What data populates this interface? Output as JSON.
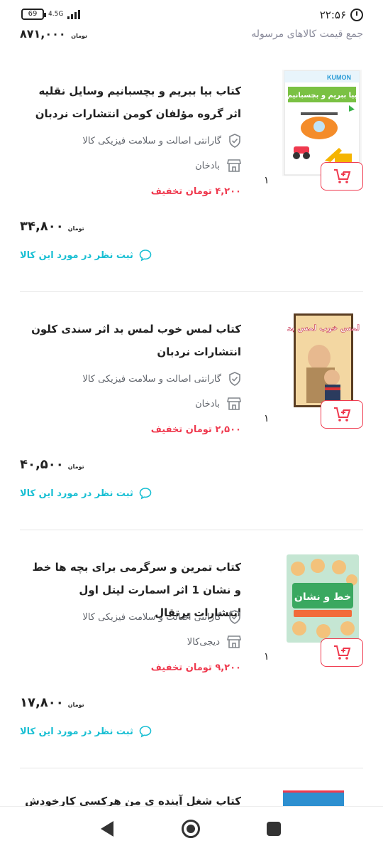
{
  "status_bar": {
    "time": "۲۲:۵۶",
    "battery": "69",
    "network": "4.5G"
  },
  "summary": {
    "label": "جمع قیمت کالاهای مرسوله",
    "price": "۸۷۱,۰۰۰",
    "currency": "تومان"
  },
  "products": [
    {
      "title": "کتاب بیا ببریم و بچسبانیم وسایل نقلیه اثر گروه مؤلفان کومن انتشارات نردبان",
      "guarantee": "گارانتی اصالت و سلامت فیزیکی کالا",
      "seller": "بادخان",
      "discount": "۴,۲۰۰ تومان تخفیف",
      "price": "۳۴,۸۰۰",
      "currency": "تومان",
      "quantity": "۱",
      "review": "ثبت نظر در مورد این کالا",
      "cover_brand": "KUMON",
      "cover_title": "بیا ببریم و بچسبانیم"
    },
    {
      "title": "کتاب لمس خوب لمس بد اثر سندی کلون انتشارات نردبان",
      "guarantee": "گارانتی اصالت و سلامت فیزیکی کالا",
      "seller": "بادخان",
      "discount": "۲,۵۰۰ تومان تخفیف",
      "price": "۴۰,۵۰۰",
      "currency": "تومان",
      "quantity": "۱",
      "review": "ثبت نظر در مورد این کالا",
      "cover_title": "لمس خوب لمس بد"
    },
    {
      "title": "کتاب تمرین و سرگرمی برای بچه ها خط و نشان 1 اثر اسمارت لیتل اول انتشارات پرتقال",
      "guarantee": "گارانتی اصالت و سلامت فیزیکی کالا",
      "seller": "دیجی‌کالا",
      "discount": "۹,۲۰۰ تومان تخفیف",
      "price": "۱۷,۸۰۰",
      "currency": "تومان",
      "quantity": "۱",
      "review": "ثبت نظر در مورد این کالا",
      "cover_title": "خط و نشان"
    }
  ],
  "partial_product": {
    "title": "کتاب شغل آینده ی من هرکسی کارخودش"
  },
  "colors": {
    "accent": "#ef394e",
    "link": "#19bfd3",
    "text": "#222222",
    "muted": "#62666d"
  }
}
